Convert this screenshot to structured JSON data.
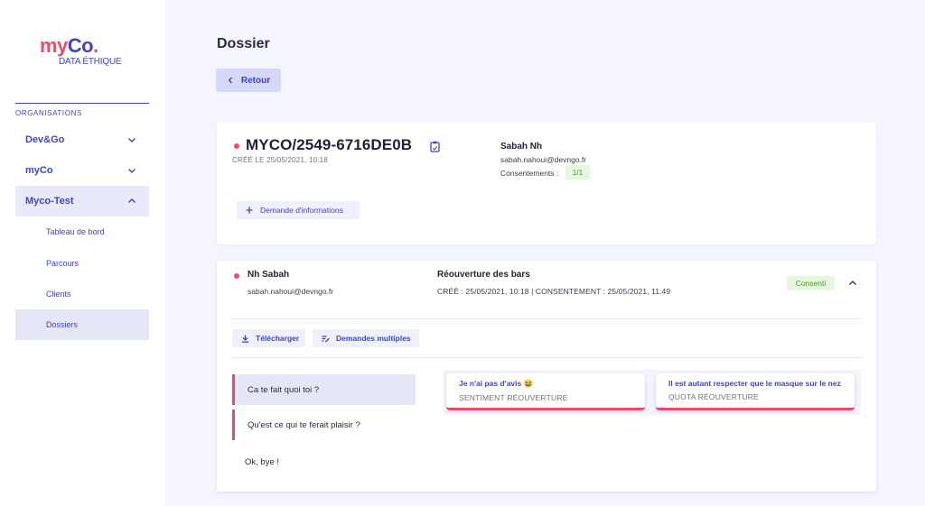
{
  "logo": {
    "brand_my": "my",
    "brand_co": "Co",
    "brand_dot": ".",
    "tagline": "DATA ÉTHIQUE"
  },
  "sidebar": {
    "section_label": "ORGANISATIONS",
    "orgs": [
      {
        "label": "Dev&Go",
        "expanded": false
      },
      {
        "label": "myCo",
        "expanded": false
      },
      {
        "label": "Myco-Test",
        "expanded": true
      }
    ],
    "subitems": [
      {
        "label": "Tableau de bord",
        "active": false
      },
      {
        "label": "Parcours",
        "active": false
      },
      {
        "label": "Clients",
        "active": false
      },
      {
        "label": "Dossiers",
        "active": true
      }
    ]
  },
  "page": {
    "title": "Dossier",
    "back_label": "Retour"
  },
  "dossier": {
    "id": "MYCO/2549-6716DE0B",
    "created": "CRÉÉ LE 25/05/2021, 10:18",
    "owner_name": "Sabah Nh",
    "owner_email": "sabah.nahoui@devngo.fr",
    "consent_label": "Consentements :",
    "consent_count": "1/1",
    "request_info_label": "Demande d'informations"
  },
  "entry": {
    "name": "Nh Sabah",
    "email": "sabah.nahoui@devngo.fr",
    "parcours": "Réouverture des bars",
    "dates": "CRÉÉ : 25/05/2021, 10:18 | CONSENTEMENT : 25/05/2021, 11:49",
    "status": "Consenti",
    "download_label": "Télécharger",
    "multi_label": "Demandes multiples",
    "questions": [
      {
        "label": "Ca te fait quoi toi ?"
      },
      {
        "label": "Qu'est ce qui te ferait plaisir ?"
      },
      {
        "label": "Ok, bye !"
      }
    ],
    "answers": [
      {
        "value": "Je n'ai pas d'avis 😆",
        "label": "SENTIMENT RÉOUVERTURE"
      },
      {
        "value": "Il est autant respecter que le masque sur le nez",
        "label": "QUOTA RÉOUVERTURE"
      }
    ]
  },
  "colors": {
    "accent": "#3f44c7",
    "brand_pink": "#e94b6d",
    "consent_bg": "#e3f8dc",
    "consent_text": "#4c9a2a"
  }
}
